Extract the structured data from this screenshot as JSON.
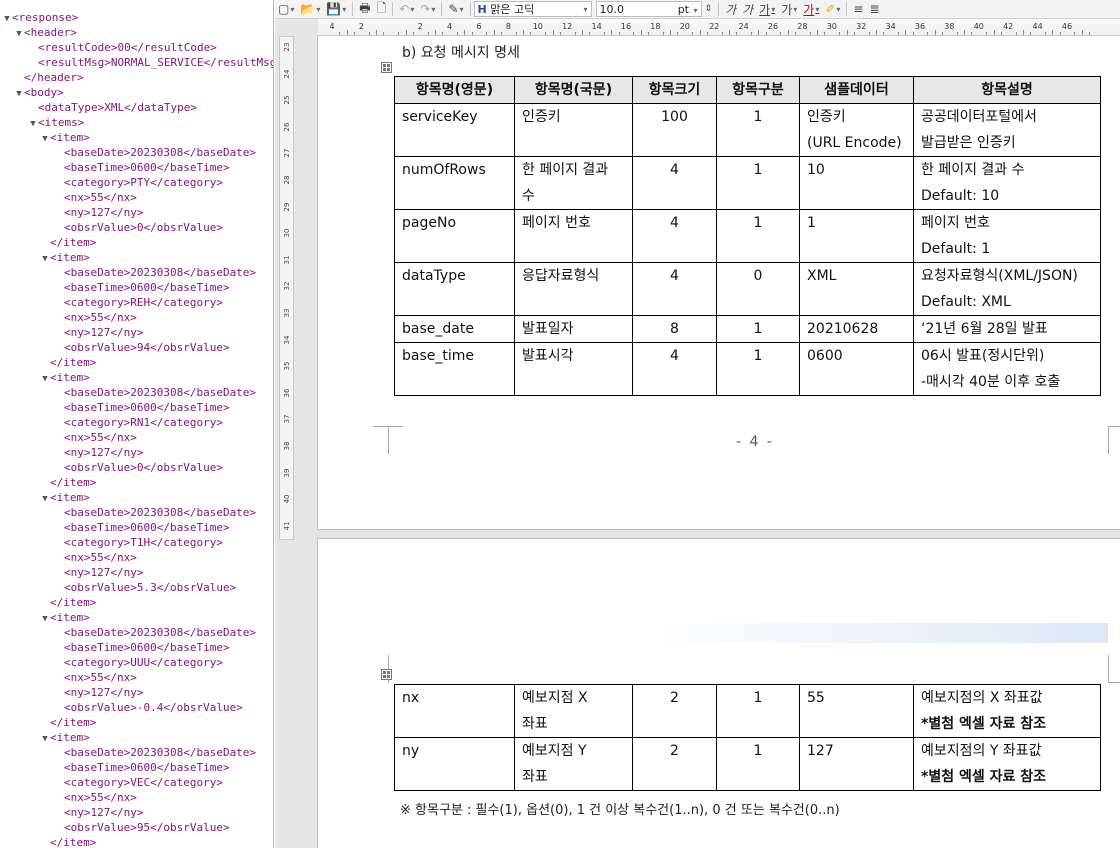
{
  "xml": {
    "response_open": "<response>",
    "header_open": "<header>",
    "result_code": "<resultCode>00</resultCode>",
    "result_msg": "<resultMsg>NORMAL_SERVICE</resultMsg>",
    "header_close": "</header>",
    "body_open": "<body>",
    "data_type": "<dataType>XML</dataType>",
    "items_open": "<items>",
    "item_open": "<item>",
    "item_close": "</item>",
    "items": [
      {
        "baseDate": "<baseDate>20230308</baseDate>",
        "baseTime": "<baseTime>0600</baseTime>",
        "category": "<category>PTY</category>",
        "nx": "<nx>55</nx>",
        "ny": "<ny>127</ny>",
        "obsrValue": "<obsrValue>0</obsrValue>"
      },
      {
        "baseDate": "<baseDate>20230308</baseDate>",
        "baseTime": "<baseTime>0600</baseTime>",
        "category": "<category>REH</category>",
        "nx": "<nx>55</nx>",
        "ny": "<ny>127</ny>",
        "obsrValue": "<obsrValue>94</obsrValue>"
      },
      {
        "baseDate": "<baseDate>20230308</baseDate>",
        "baseTime": "<baseTime>0600</baseTime>",
        "category": "<category>RN1</category>",
        "nx": "<nx>55</nx>",
        "ny": "<ny>127</ny>",
        "obsrValue": "<obsrValue>0</obsrValue>"
      },
      {
        "baseDate": "<baseDate>20230308</baseDate>",
        "baseTime": "<baseTime>0600</baseTime>",
        "category": "<category>T1H</category>",
        "nx": "<nx>55</nx>",
        "ny": "<ny>127</ny>",
        "obsrValue": "<obsrValue>5.3</obsrValue>"
      },
      {
        "baseDate": "<baseDate>20230308</baseDate>",
        "baseTime": "<baseTime>0600</baseTime>",
        "category": "<category>UUU</category>",
        "nx": "<nx>55</nx>",
        "ny": "<ny>127</ny>",
        "obsrValue": "<obsrValue>-0.4</obsrValue>"
      },
      {
        "baseDate": "<baseDate>20230308</baseDate>",
        "baseTime": "<baseTime>0600</baseTime>",
        "category": "<category>VEC</category>",
        "nx": "<nx>55</nx>",
        "ny": "<ny>127</ny>",
        "obsrValue": "<obsrValue>95</obsrValue>"
      }
    ]
  },
  "toolbar": {
    "font_name": "맑은 고딕",
    "font_size": "10.0",
    "font_unit": "pt"
  },
  "ruler": {
    "h_numbers": [
      "4",
      "2",
      "",
      "2",
      "4",
      "6",
      "8",
      "10",
      "12",
      "14",
      "16",
      "18",
      "20",
      "22",
      "24",
      "26",
      "28",
      "30",
      "32",
      "34",
      "36",
      "38",
      "40",
      "42",
      "44",
      "46"
    ],
    "v_numbers": [
      "23",
      "24",
      "25",
      "26",
      "27",
      "28",
      "29",
      "30",
      "31",
      "32",
      "33",
      "34",
      "35",
      "36",
      "37",
      "38",
      "39",
      "40",
      "41"
    ]
  },
  "doc": {
    "section_heading": "b) 요청 메시지 명세",
    "headers": [
      "항목명(영문)",
      "항목명(국문)",
      "항목크기",
      "항목구분",
      "샘플데이터",
      "항목설명"
    ],
    "rows_page1": [
      {
        "en": "serviceKey",
        "ko": [
          "인증키"
        ],
        "size": "100",
        "kind": "1",
        "sample": [
          "인증키",
          "(URL Encode)"
        ],
        "desc": [
          "공공데이터포털에서",
          "발급받은 인증키"
        ]
      },
      {
        "en": "numOfRows",
        "ko": [
          "한 페이지 결과",
          "수"
        ],
        "size": "4",
        "kind": "1",
        "sample": [
          "10"
        ],
        "desc": [
          "한 페이지 결과 수",
          "Default: 10"
        ]
      },
      {
        "en": "pageNo",
        "ko": [
          "페이지 번호"
        ],
        "size": "4",
        "kind": "1",
        "sample": [
          "1"
        ],
        "desc": [
          "페이지 번호",
          "Default: 1"
        ]
      },
      {
        "en": "dataType",
        "ko": [
          "응답자료형식"
        ],
        "size": "4",
        "kind": "0",
        "sample": [
          "XML"
        ],
        "desc": [
          "요청자료형식(XML/JSON)",
          "Default: XML"
        ]
      },
      {
        "en": "base_date",
        "ko": [
          "발표일자"
        ],
        "size": "8",
        "kind": "1",
        "sample": [
          "20210628"
        ],
        "desc": [
          "‘21년 6월 28일 발표"
        ]
      },
      {
        "en": "base_time",
        "ko": [
          "발표시각"
        ],
        "size": "4",
        "kind": "1",
        "sample": [
          "0600"
        ],
        "desc": [
          "06시 발표(정시단위)",
          "-매시각 40분 이후 호출"
        ]
      }
    ],
    "page_number": "- 4 -",
    "rows_page2": [
      {
        "en": "nx",
        "ko": [
          "예보지점 X",
          "좌표"
        ],
        "size": "2",
        "kind": "1",
        "sample": [
          "55"
        ],
        "desc": [
          "예보지점의 X 좌표값",
          "*별첨 엑셀 자료 참조"
        ]
      },
      {
        "en": "ny",
        "ko": [
          "예보지점 Y",
          "좌표"
        ],
        "size": "2",
        "kind": "1",
        "sample": [
          "127"
        ],
        "desc": [
          "예보지점의 Y 좌표값",
          "*별첨 엑셀 자료 참조"
        ]
      }
    ],
    "footnote": "※ 항목구분 : 필수(1), 옵션(0), 1 건 이상 복수건(1..n), 0 건 또는 복수건(0..n)"
  }
}
